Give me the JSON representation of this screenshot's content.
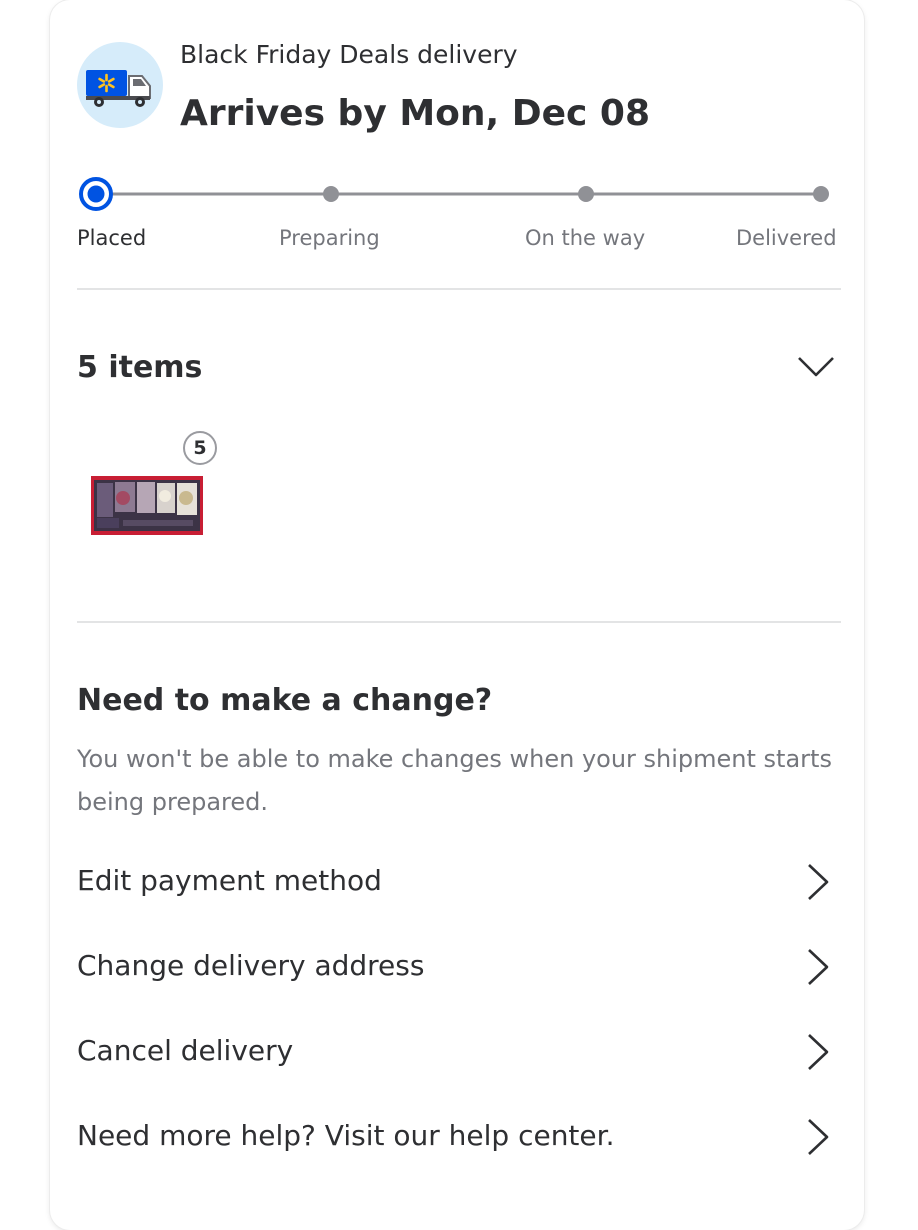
{
  "shipment": {
    "delivery_type": "Black Friday Deals delivery",
    "arrival": "Arrives by Mon, Dec 08",
    "truck_icon": "walmart-delivery-truck-icon"
  },
  "progress": {
    "active_index": 0,
    "accent_color": "#0053e2",
    "steps": [
      {
        "label": "Placed"
      },
      {
        "label": "Preparing"
      },
      {
        "label": "On the way"
      },
      {
        "label": "Delivered"
      }
    ]
  },
  "items": {
    "title": "5 items",
    "quantity_badge": "5",
    "expand_icon": "chevron-down-icon"
  },
  "changes": {
    "title": "Need to make a change?",
    "description": "You won't be able to make changes when your shipment starts being prepared.",
    "actions": [
      {
        "label": "Edit payment method"
      },
      {
        "label": "Change delivery address"
      },
      {
        "label": "Cancel delivery"
      },
      {
        "label": "Need more help? Visit our help center."
      }
    ]
  },
  "colors": {
    "text_primary": "#2e2f32",
    "text_secondary": "#74767c",
    "divider": "#e3e4e5",
    "truck_blue": "#0053e2",
    "spark_yellow": "#ffc220"
  }
}
